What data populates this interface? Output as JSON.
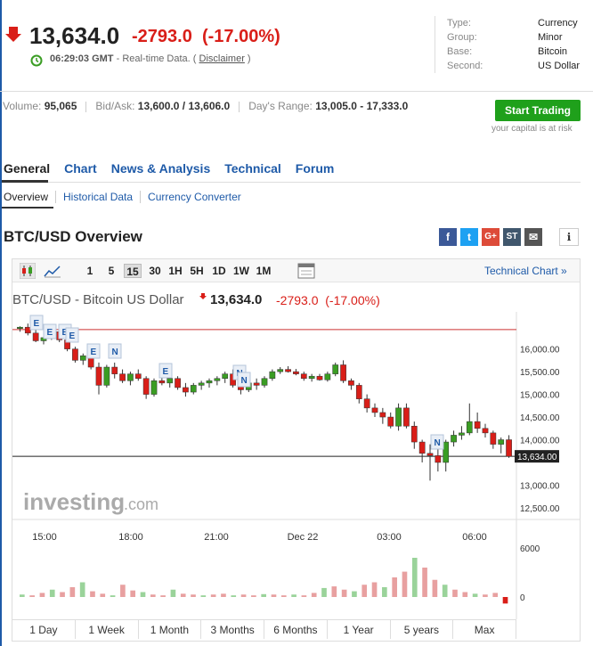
{
  "quote": {
    "price": "13,634.0",
    "change": "-2793.0",
    "change_pct": "(-17.00%)",
    "time": "06:29:03 GMT",
    "realtime_label": "- Real-time Data. (",
    "disclaimer": "Disclaimer",
    "close_paren": ")"
  },
  "meta": [
    {
      "key": "Type:",
      "value": "Currency"
    },
    {
      "key": "Group:",
      "value": "Minor"
    },
    {
      "key": "Base:",
      "value": "Bitcoin"
    },
    {
      "key": "Second:",
      "value": "US Dollar"
    }
  ],
  "stats": {
    "volume_label": "Volume:",
    "volume": "95,065",
    "bidask_label": "Bid/Ask:",
    "bidask": "13,600.0 / 13,606.0",
    "range_label": "Day's Range:",
    "range": "13,005.0 - 17,333.0"
  },
  "cta": {
    "start_trading": "Start Trading",
    "risk": "your capital is at risk"
  },
  "nav": [
    "General",
    "Chart",
    "News & Analysis",
    "Technical",
    "Forum"
  ],
  "subnav": [
    "Overview",
    "Historical Data",
    "Currency Converter"
  ],
  "overview_title": "BTC/USD Overview",
  "share_icons": [
    "facebook-icon",
    "twitter-icon",
    "google-plus-icon",
    "stocktwits-icon",
    "email-icon"
  ],
  "toolbar": {
    "intervals": [
      "1",
      "5",
      "15",
      "30",
      "1H",
      "5H",
      "1D",
      "1W",
      "1M"
    ],
    "selected": "15",
    "technical_chart": "Technical Chart »"
  },
  "chart_header": {
    "title": "BTC/USD - Bitcoin US Dollar",
    "price": "13,634.0",
    "change": "-2793.0",
    "change_pct": "(-17.00%)"
  },
  "chart_data": {
    "type": "candlestick",
    "y_ticks": [
      "16,000.00",
      "15,500.00",
      "15,000.00",
      "14,500.00",
      "14,000.00",
      "13,000.00",
      "12,500.00"
    ],
    "ylim": [
      12400,
      16700
    ],
    "x_ticks": [
      "15:00",
      "18:00",
      "21:00",
      "Dec 22",
      "03:00",
      "06:00"
    ],
    "current_label": "13,634.00",
    "current_value": 13634,
    "prev_close_value": 16427,
    "volume_ticks": [
      "6000",
      "0"
    ],
    "event_markers": [
      "E",
      "E",
      "E",
      "E",
      "E",
      "N",
      "E",
      "N",
      "N",
      "N"
    ],
    "watermark": "investing.com",
    "candles": [
      [
        16450,
        16500,
        16380,
        16480
      ],
      [
        16480,
        16560,
        16300,
        16350
      ],
      [
        16350,
        16420,
        16150,
        16180
      ],
      [
        16180,
        16300,
        16100,
        16250
      ],
      [
        16250,
        16400,
        16200,
        16380
      ],
      [
        16380,
        16420,
        16150,
        16200
      ],
      [
        16200,
        16250,
        15950,
        16000
      ],
      [
        16000,
        16050,
        15700,
        15750
      ],
      [
        15750,
        15900,
        15650,
        15850
      ],
      [
        15850,
        15900,
        15550,
        15600
      ],
      [
        15600,
        15700,
        15000,
        15200
      ],
      [
        15200,
        15650,
        15150,
        15600
      ],
      [
        15600,
        15700,
        15350,
        15450
      ],
      [
        15450,
        15550,
        15250,
        15300
      ],
      [
        15300,
        15500,
        15200,
        15450
      ],
      [
        15450,
        15550,
        15300,
        15350
      ],
      [
        15350,
        15400,
        14900,
        15000
      ],
      [
        15000,
        15350,
        14950,
        15300
      ],
      [
        15300,
        15450,
        15200,
        15250
      ],
      [
        15250,
        15400,
        15150,
        15350
      ],
      [
        15350,
        15400,
        15100,
        15150
      ],
      [
        15150,
        15250,
        14950,
        15050
      ],
      [
        15050,
        15250,
        15000,
        15200
      ],
      [
        15200,
        15300,
        15100,
        15250
      ],
      [
        15250,
        15350,
        15150,
        15300
      ],
      [
        15300,
        15400,
        15200,
        15350
      ],
      [
        15350,
        15500,
        15250,
        15450
      ],
      [
        15450,
        15550,
        15150,
        15200
      ],
      [
        15200,
        15400,
        15000,
        15100
      ],
      [
        15100,
        15300,
        15050,
        15250
      ],
      [
        15250,
        15350,
        15100,
        15200
      ],
      [
        15200,
        15400,
        15150,
        15350
      ],
      [
        15350,
        15550,
        15300,
        15500
      ],
      [
        15500,
        15600,
        15450,
        15550
      ],
      [
        15550,
        15620,
        15480,
        15500
      ],
      [
        15500,
        15560,
        15420,
        15450
      ],
      [
        15450,
        15500,
        15300,
        15350
      ],
      [
        15350,
        15450,
        15280,
        15400
      ],
      [
        15400,
        15450,
        15300,
        15320
      ],
      [
        15320,
        15500,
        15280,
        15450
      ],
      [
        15450,
        15700,
        15400,
        15650
      ],
      [
        15650,
        15750,
        15250,
        15300
      ],
      [
        15300,
        15350,
        15100,
        15200
      ],
      [
        15200,
        15250,
        14800,
        14900
      ],
      [
        14900,
        15000,
        14600,
        14700
      ],
      [
        14700,
        14800,
        14500,
        14600
      ],
      [
        14600,
        14700,
        14350,
        14500
      ],
      [
        14500,
        14600,
        14250,
        14300
      ],
      [
        14300,
        14800,
        14200,
        14700
      ],
      [
        14700,
        14800,
        14250,
        14300
      ],
      [
        14300,
        14400,
        13800,
        13950
      ],
      [
        13950,
        14000,
        13500,
        13700
      ],
      [
        13700,
        13900,
        13100,
        13650
      ],
      [
        13650,
        13800,
        13300,
        13500
      ],
      [
        13500,
        14000,
        13300,
        13950
      ],
      [
        13950,
        14200,
        13850,
        14100
      ],
      [
        14100,
        14300,
        14000,
        14150
      ],
      [
        14150,
        14800,
        14100,
        14400
      ],
      [
        14400,
        14600,
        14150,
        14250
      ],
      [
        14250,
        14350,
        14050,
        14150
      ],
      [
        14150,
        14200,
        13800,
        13900
      ],
      [
        13900,
        14050,
        13700,
        14000
      ],
      [
        14000,
        14100,
        13600,
        13634
      ]
    ],
    "volume": [
      300,
      200,
      500,
      900,
      600,
      1200,
      1800,
      700,
      400,
      200,
      1500,
      800,
      600,
      300,
      200,
      900,
      400,
      300,
      200,
      300,
      400,
      200,
      300,
      200,
      350,
      300,
      200,
      300,
      200,
      500,
      1100,
      1300,
      900,
      700,
      1500,
      1800,
      1200,
      2400,
      3100,
      4800,
      3600,
      2100,
      1500,
      900,
      600,
      400,
      300,
      500,
      -800
    ]
  },
  "range_buttons": [
    "1 Day",
    "1 Week",
    "1 Month",
    "3 Months",
    "6 Months",
    "1 Year",
    "5 years",
    "Max"
  ]
}
